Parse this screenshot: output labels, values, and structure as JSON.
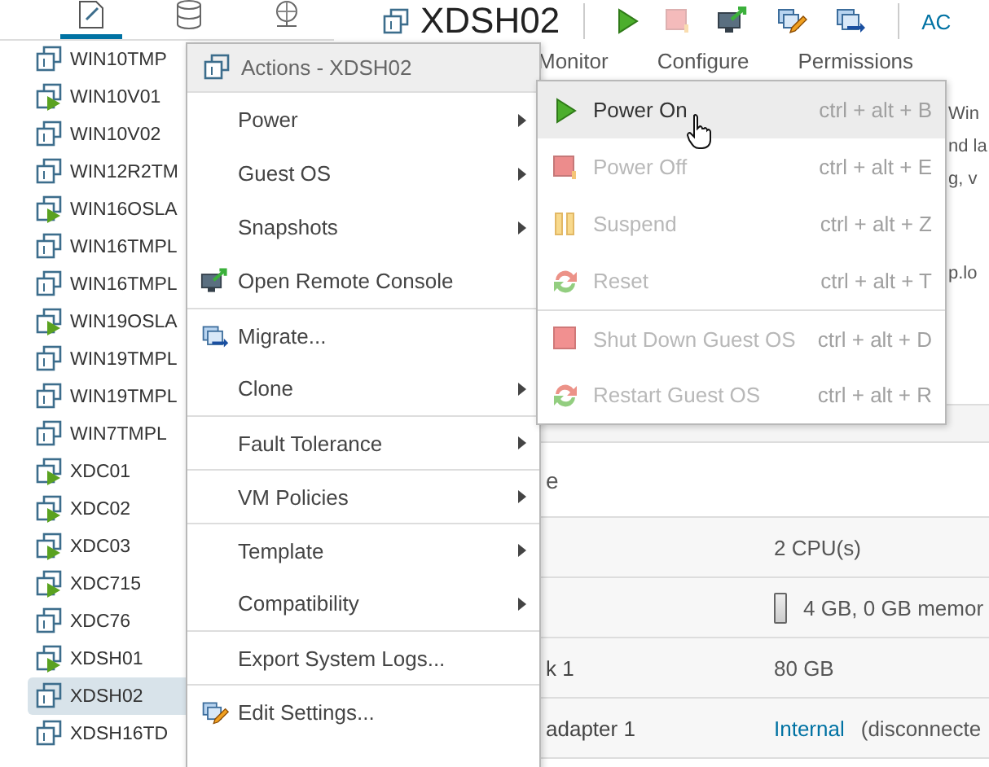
{
  "sidebar": {
    "tabs": [
      {
        "kind": "vms",
        "selected": true
      },
      {
        "kind": "storage",
        "selected": false
      },
      {
        "kind": "network",
        "selected": false
      }
    ],
    "tree": [
      {
        "label": "WIN10TMP",
        "running": false,
        "selected": false
      },
      {
        "label": "WIN10V01",
        "running": true,
        "selected": false
      },
      {
        "label": "WIN10V02",
        "running": false,
        "selected": false
      },
      {
        "label": "WIN12R2TM",
        "running": false,
        "selected": false
      },
      {
        "label": "WIN16OSLA",
        "running": true,
        "selected": false
      },
      {
        "label": "WIN16TMPL",
        "running": false,
        "selected": false
      },
      {
        "label": "WIN16TMPL",
        "running": false,
        "selected": false
      },
      {
        "label": "WIN19OSLA",
        "running": true,
        "selected": false
      },
      {
        "label": "WIN19TMPL",
        "running": false,
        "selected": false
      },
      {
        "label": "WIN19TMPL",
        "running": false,
        "selected": false
      },
      {
        "label": "WIN7TMPL",
        "running": false,
        "selected": false
      },
      {
        "label": "XDC01",
        "running": true,
        "selected": false
      },
      {
        "label": "XDC02",
        "running": true,
        "selected": false
      },
      {
        "label": "XDC03",
        "running": true,
        "selected": false
      },
      {
        "label": "XDC715",
        "running": true,
        "selected": false
      },
      {
        "label": "XDC76",
        "running": false,
        "selected": false
      },
      {
        "label": "XDSH01",
        "running": true,
        "selected": false
      },
      {
        "label": "XDSH02",
        "running": false,
        "selected": true
      },
      {
        "label": "XDSH16TD",
        "running": false,
        "selected": false
      }
    ]
  },
  "header": {
    "title": "XDSH02",
    "toolbar": [
      {
        "kind": "power-on",
        "disabled": false
      },
      {
        "kind": "power-off",
        "disabled": true
      },
      {
        "kind": "console",
        "disabled": false
      },
      {
        "kind": "edit",
        "disabled": false
      },
      {
        "kind": "migrate",
        "disabled": false
      }
    ],
    "actions_label": "AC"
  },
  "tabs": [
    "Monitor",
    "Configure",
    "Permissions"
  ],
  "summary_lines": [
    "Win",
    "nd la",
    "g, v"
  ],
  "summary_extra": "p.lo",
  "section_title": "e",
  "rows": [
    {
      "kind": "text",
      "value": "2 CPU(s)"
    },
    {
      "kind": "memory",
      "value": "4 GB, 0 GB memor"
    },
    {
      "kind": "text",
      "label": "k 1",
      "value": "80 GB"
    },
    {
      "kind": "link",
      "label": "adapter 1",
      "value": "Internal",
      "note": "(disconnecte"
    }
  ],
  "menu": {
    "title": "Actions - XDSH02",
    "items": [
      {
        "label": "Power",
        "kind": "plain",
        "submenu": true,
        "divider_before": false
      },
      {
        "label": "Guest OS",
        "kind": "plain",
        "submenu": true,
        "divider_before": false
      },
      {
        "label": "Snapshots",
        "kind": "plain",
        "submenu": true,
        "divider_before": false
      },
      {
        "label": "Open Remote Console",
        "kind": "console",
        "submenu": false,
        "divider_before": false
      },
      {
        "label": "Migrate...",
        "kind": "migrate",
        "submenu": false,
        "divider_before": true
      },
      {
        "label": "Clone",
        "kind": "plain",
        "submenu": true,
        "divider_before": false
      },
      {
        "label": "Fault Tolerance",
        "kind": "plain",
        "submenu": true,
        "divider_before": true
      },
      {
        "label": "VM Policies",
        "kind": "plain",
        "submenu": true,
        "divider_before": true
      },
      {
        "label": "Template",
        "kind": "plain",
        "submenu": true,
        "divider_before": true
      },
      {
        "label": "Compatibility",
        "kind": "plain",
        "submenu": true,
        "divider_before": false
      },
      {
        "label": "Export System Logs...",
        "kind": "plain",
        "submenu": false,
        "divider_before": true
      },
      {
        "label": "Edit Settings...",
        "kind": "edit",
        "submenu": false,
        "divider_before": true
      }
    ]
  },
  "submenu": [
    {
      "label": "Power On",
      "shortcut": "ctrl + alt + B",
      "kind": "power-on",
      "disabled": false,
      "selected": true,
      "divider_before": false
    },
    {
      "label": "Power Off",
      "shortcut": "ctrl + alt + E",
      "kind": "power-off",
      "disabled": true,
      "selected": false,
      "divider_before": false
    },
    {
      "label": "Suspend",
      "shortcut": "ctrl + alt + Z",
      "kind": "suspend",
      "disabled": true,
      "selected": false,
      "divider_before": false
    },
    {
      "label": "Reset",
      "shortcut": "ctrl + alt + T",
      "kind": "reset",
      "disabled": true,
      "selected": false,
      "divider_before": false
    },
    {
      "label": "Shut Down Guest OS",
      "shortcut": "ctrl + alt + D",
      "kind": "shutdown",
      "disabled": true,
      "selected": false,
      "divider_before": true
    },
    {
      "label": "Restart Guest OS",
      "shortcut": "ctrl + alt + R",
      "kind": "restart",
      "disabled": true,
      "selected": false,
      "divider_before": false
    }
  ]
}
